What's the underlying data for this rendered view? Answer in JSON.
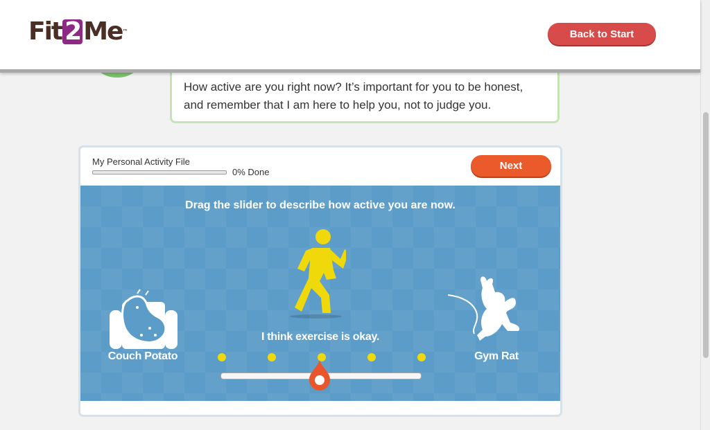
{
  "header": {
    "logo": {
      "part1": "Fit",
      "part2": "2",
      "part3": "Me",
      "mark": "™"
    },
    "back_button": "Back to Start"
  },
  "coach": {
    "message_line1": "How active are you right now? It’s important for you to be honest,",
    "message_line2": "and remember that I am here to help you, not to judge you."
  },
  "activity": {
    "file_title": "My Personal Activity File",
    "progress_percent": 0,
    "progress_text": "0% Done",
    "next_button": "Next",
    "instruction": "Drag the slider to describe how active you are now.",
    "current_label": "I think exercise is okay.",
    "left_label": "Couch Potato",
    "right_label": "Gym Rat",
    "slider_positions": 5,
    "slider_value": 3,
    "icons": [
      "couch-potato-icon",
      "runner-icon",
      "gym-rat-icon"
    ]
  },
  "colors": {
    "brand_purple": "#8e2a86",
    "back_button": "#d84b4b",
    "next_button": "#ea5a2b",
    "panel_blue": "#5b9cc8",
    "accent_yellow": "#f0d90b",
    "bubble_border": "#c6e3b5"
  }
}
